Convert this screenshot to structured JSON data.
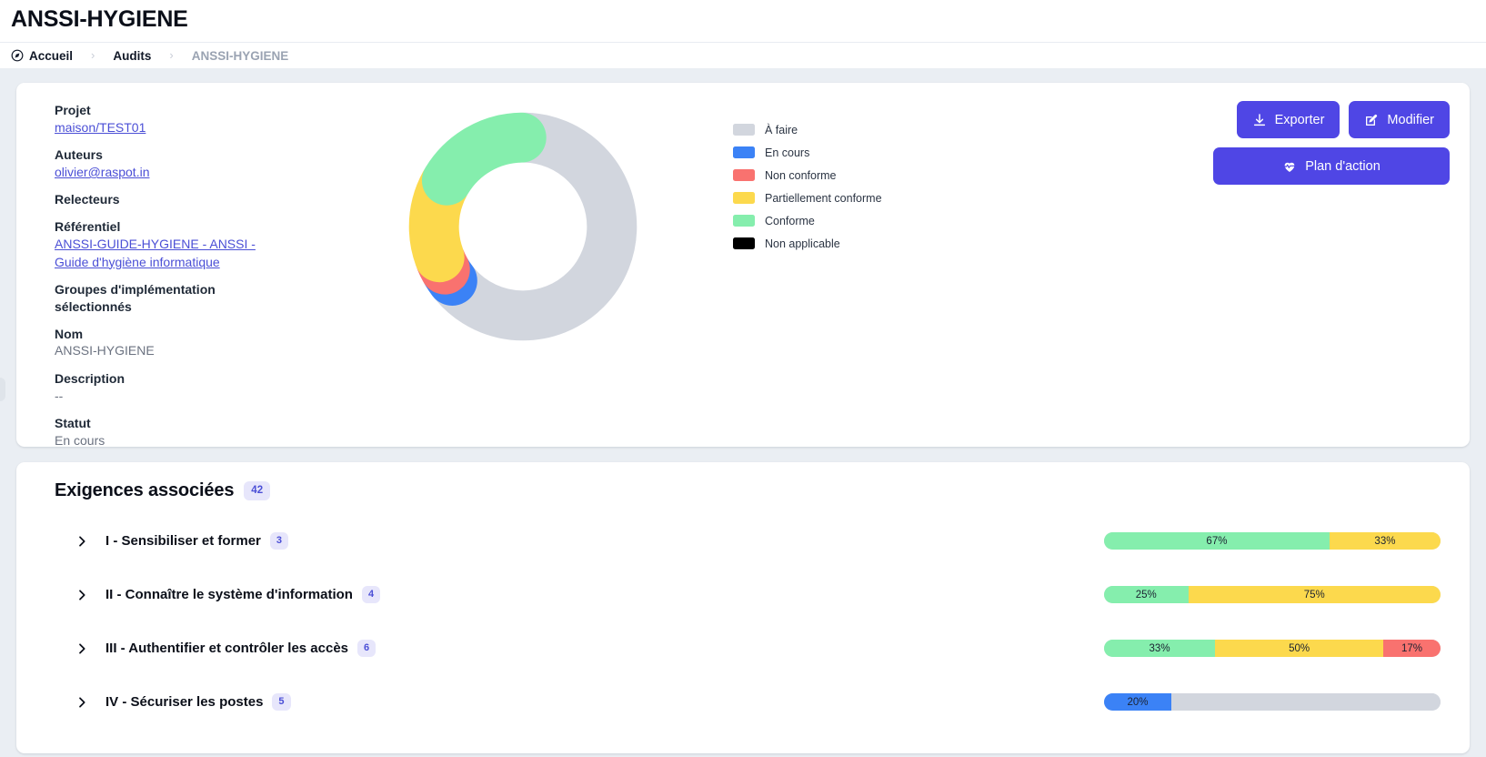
{
  "header": {
    "title": "ANSSI-HYGIENE",
    "breadcrumb": {
      "home_label": "Accueil",
      "home_icon": "compass-icon",
      "separator": "›",
      "section_label": "Audits",
      "current_label": "ANSSI-HYGIENE"
    }
  },
  "summary": {
    "fields": [
      {
        "label": "Projet",
        "value": "maison/TEST01",
        "type": "link"
      },
      {
        "label": "Auteurs",
        "value": "olivier@raspot.in",
        "type": "link"
      },
      {
        "label": "Relecteurs",
        "value": "",
        "type": "empty"
      },
      {
        "label": "Référentiel",
        "value": "ANSSI-GUIDE-HYGIENE - ANSSI - Guide d'hygiène informatique",
        "type": "link"
      },
      {
        "label": "Groupes d'implémentation sélectionnés",
        "value": "",
        "type": "empty"
      },
      {
        "label": "Nom",
        "value": "ANSSI-HYGIENE",
        "type": "text"
      },
      {
        "label": "Description",
        "value": "--",
        "type": "text"
      },
      {
        "label": "Statut",
        "value": "En cours",
        "type": "text"
      }
    ],
    "actions": {
      "export_label": "Exporter",
      "export_icon": "download-icon",
      "edit_label": "Modifier",
      "edit_icon": "pencil-square-icon",
      "action_plan_label": "Plan d'action",
      "action_plan_icon": "heart-pulse-icon"
    }
  },
  "colors": {
    "todo": "#d2d6de",
    "in_progress": "#3b82f6",
    "non_compliant": "#f9726f",
    "partially_compliant": "#fcd94d",
    "compliant": "#85eead",
    "not_applicable": "#000000",
    "accent": "#4f46e5",
    "badge_bg": "#e7e6fb",
    "badge_text": "#4b4fd6",
    "page_bg": "#eaeef3",
    "card_bg": "#ffffff"
  },
  "chart_data": {
    "type": "pie",
    "variant": "donut",
    "title": "",
    "legend_position": "right",
    "start_angle_deg": 0,
    "direction": "clockwise",
    "categories": [
      "À faire",
      "En cours",
      "Non conforme",
      "Partiellement conforme",
      "Conforme"
    ],
    "values": [
      64.3,
      2.4,
      2.4,
      14.3,
      16.7
    ],
    "colors": [
      "#d2d6de",
      "#3b82f6",
      "#f9726f",
      "#fcd94d",
      "#85eead"
    ],
    "legend": [
      {
        "label": "À faire",
        "color": "#d2d6de"
      },
      {
        "label": "En cours",
        "color": "#3b82f6"
      },
      {
        "label": "Non conforme",
        "color": "#f9726f"
      },
      {
        "label": "Partiellement conforme",
        "color": "#fcd94d"
      },
      {
        "label": "Conforme",
        "color": "#85eead"
      },
      {
        "label": "Non applicable",
        "color": "#000000"
      }
    ]
  },
  "requirements": {
    "title": "Exigences associées",
    "total_count": "42",
    "rows": [
      {
        "name": "I - Sensibiliser et former",
        "count": "3",
        "chevron": "chevron-right-icon",
        "segments": [
          {
            "label": "67%",
            "pct": 67,
            "color": "#85eead",
            "status": "Conforme"
          },
          {
            "label": "33%",
            "pct": 33,
            "color": "#fcd94d",
            "status": "Partiellement conforme"
          }
        ]
      },
      {
        "name": "II - Connaître le système d'information",
        "count": "4",
        "chevron": "chevron-right-icon",
        "segments": [
          {
            "label": "25%",
            "pct": 25,
            "color": "#85eead",
            "status": "Conforme"
          },
          {
            "label": "75%",
            "pct": 75,
            "color": "#fcd94d",
            "status": "Partiellement conforme"
          }
        ]
      },
      {
        "name": "III - Authentifier et contrôler les accès",
        "count": "6",
        "chevron": "chevron-right-icon",
        "segments": [
          {
            "label": "33%",
            "pct": 33,
            "color": "#85eead",
            "status": "Conforme"
          },
          {
            "label": "50%",
            "pct": 50,
            "color": "#fcd94d",
            "status": "Partiellement conforme"
          },
          {
            "label": "17%",
            "pct": 17,
            "color": "#f9726f",
            "status": "Non conforme"
          }
        ]
      },
      {
        "name": "IV - Sécuriser les postes",
        "count": "5",
        "chevron": "chevron-right-icon",
        "segments": [
          {
            "label": "20%",
            "pct": 20,
            "color": "#3b82f6",
            "status": "En cours"
          },
          {
            "label": "",
            "pct": 80,
            "color": "#d2d6de",
            "status": "À faire"
          }
        ]
      }
    ]
  }
}
